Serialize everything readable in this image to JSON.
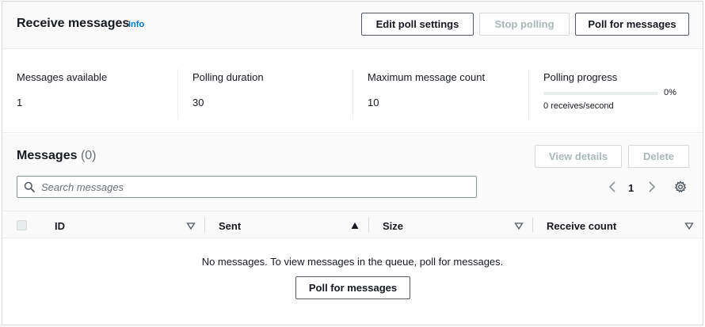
{
  "receive": {
    "title": "Receive messages",
    "info_label": "Info",
    "buttons": {
      "edit": "Edit poll settings",
      "stop": "Stop polling",
      "poll": "Poll for messages"
    },
    "stats": {
      "messages_available": {
        "label": "Messages available",
        "value": "1"
      },
      "polling_duration": {
        "label": "Polling duration",
        "value": "30"
      },
      "max_message_count": {
        "label": "Maximum message count",
        "value": "10"
      },
      "polling_progress": {
        "label": "Polling progress",
        "percent": "0%",
        "progress": 0,
        "rate": "0 receives/second"
      }
    }
  },
  "messages": {
    "title": "Messages",
    "count": "(0)",
    "buttons": {
      "view_details": "View details",
      "delete": "Delete"
    },
    "search": {
      "placeholder": "Search messages",
      "value": ""
    },
    "pagination": {
      "current_page": "1"
    },
    "columns": [
      "ID",
      "Sent",
      "Size",
      "Receive count"
    ],
    "sorted_column": "Sent",
    "empty_text": "No messages. To view messages in the queue, poll for messages.",
    "empty_button": "Poll for messages"
  },
  "colors": {
    "link": "#0073bb",
    "text": "#16191f",
    "disabled": "#aab7b8",
    "header_bg": "#fafafa"
  },
  "icons": {
    "search": "search-icon",
    "prev": "chevron-left-icon",
    "next": "chevron-right-icon",
    "settings": "gear-icon",
    "sort": "caret-down-outline-icon",
    "sorted": "caret-up-filled-icon"
  }
}
